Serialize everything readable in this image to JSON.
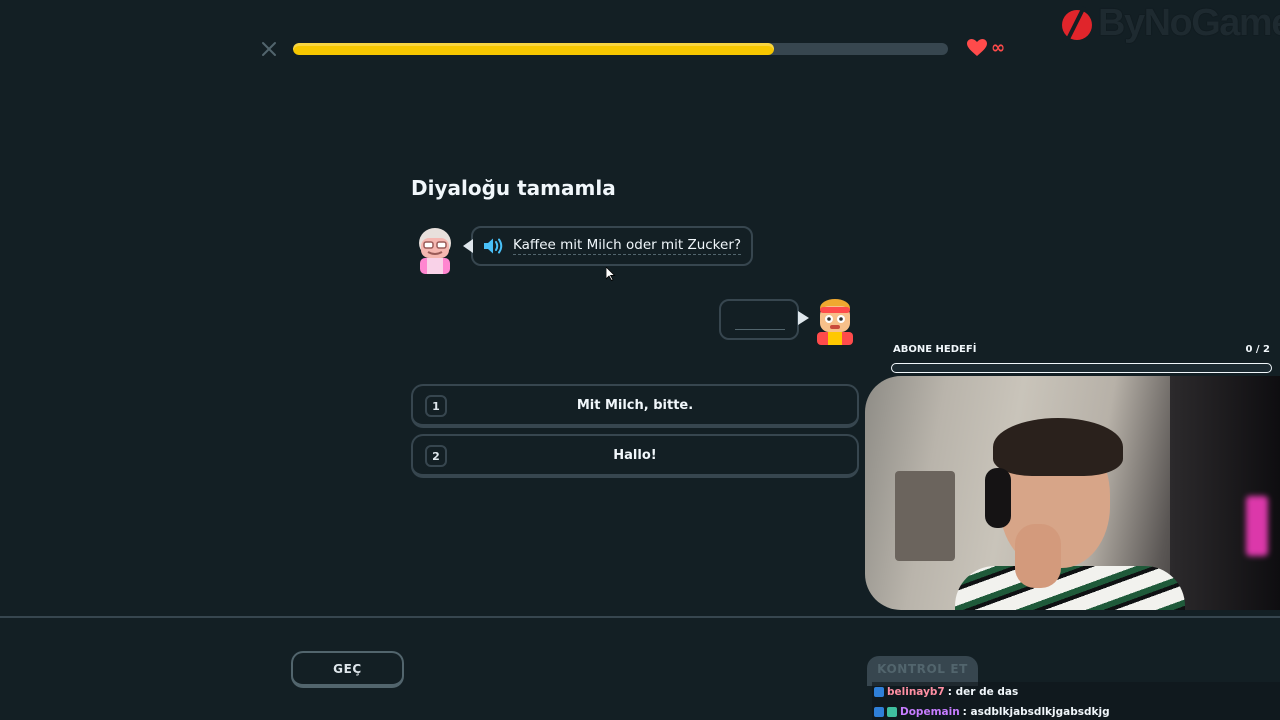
{
  "progress": {
    "fraction": 0.735
  },
  "hearts": {
    "count": "∞",
    "color": "#ff4b4b"
  },
  "watermark": {
    "text": "ByNoGame"
  },
  "challenge": {
    "title": "Diyaloğu tamamla",
    "prompt": "Kaffee mit Milch oder mit Zucker?",
    "choices": [
      {
        "number": "1",
        "label": "Mit Milch, bitte."
      },
      {
        "number": "2",
        "label": "Hallo!"
      }
    ]
  },
  "footer": {
    "skip_label": "GEÇ",
    "check_label": "KONTROL ET"
  },
  "stream": {
    "sub_goal_label": "ABONE HEDEFİ",
    "sub_goal_count": "0 / 2",
    "chat": [
      {
        "user": "belinayb7",
        "user_color": "#ff8fa3",
        "message": ": der de das"
      },
      {
        "user": "Dopemain",
        "user_color": "#c77dff",
        "message": ": asdblkjabsdlkjgabsdkjg"
      }
    ]
  },
  "colors": {
    "background": "#131f24",
    "progress_fill": "#f6c700",
    "border": "#37464f",
    "accent_blue": "#49c0f8"
  }
}
